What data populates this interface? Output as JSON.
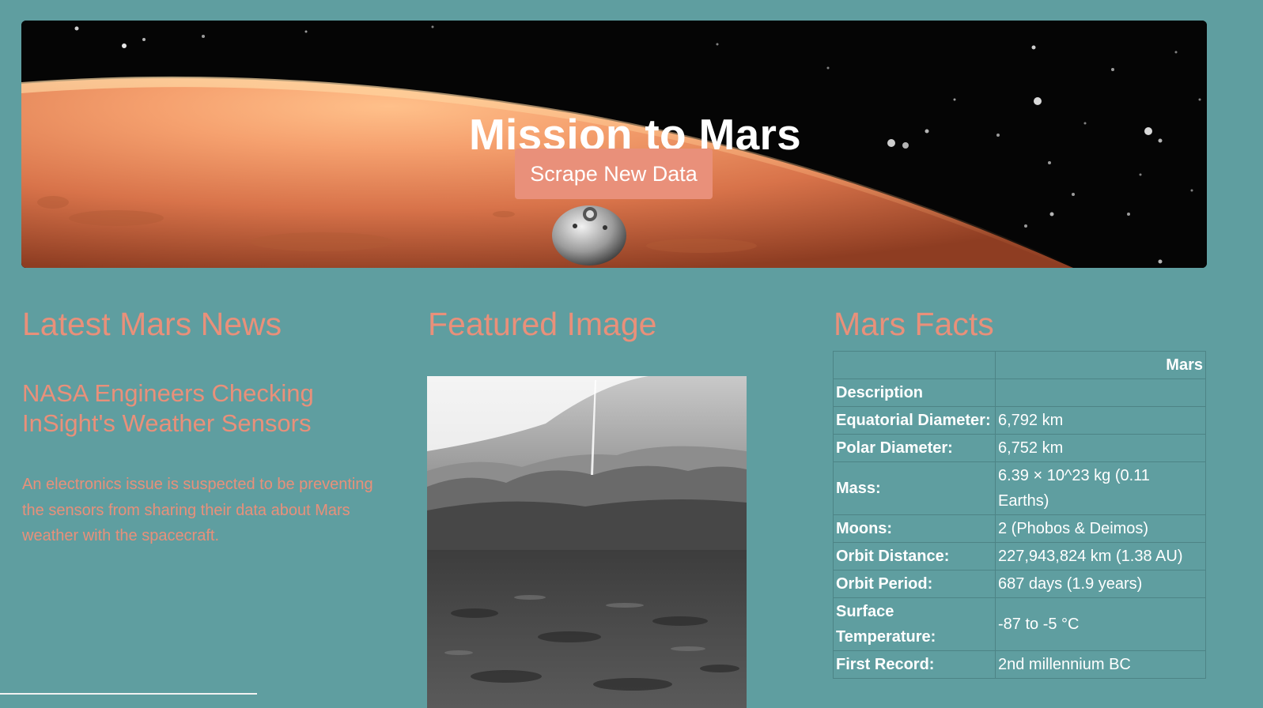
{
  "hero": {
    "title": "Mission to Mars",
    "scrape_button_label": "Scrape New Data"
  },
  "news": {
    "heading": "Latest Mars News",
    "title": "NASA Engineers Checking InSight's Weather Sensors",
    "teaser": "An electronics issue is suspected to be preventing the sensors from sharing their data about Mars weather with the spacecraft."
  },
  "featured": {
    "heading": "Featured Image"
  },
  "facts": {
    "heading": "Mars Facts",
    "column_header": "Mars",
    "rows": [
      {
        "label": "Description",
        "value": ""
      },
      {
        "label": "Equatorial Diameter:",
        "value": "6,792 km"
      },
      {
        "label": "Polar Diameter:",
        "value": "6,752 km"
      },
      {
        "label": "Mass:",
        "value": "6.39 × 10^23 kg (0.11 Earths)"
      },
      {
        "label": "Moons:",
        "value": "2 (Phobos & Deimos)"
      },
      {
        "label": "Orbit Distance:",
        "value": "227,943,824 km (1.38 AU)"
      },
      {
        "label": "Orbit Period:",
        "value": "687 days (1.9 years)"
      },
      {
        "label": "Surface Temperature:",
        "value": "-87 to -5 °C"
      },
      {
        "label": "First Record:",
        "value": "2nd millennium BC"
      }
    ]
  },
  "colors": {
    "page_background": "#5f9ea0",
    "accent": "#e9907a",
    "table_text": "#ffffff"
  }
}
